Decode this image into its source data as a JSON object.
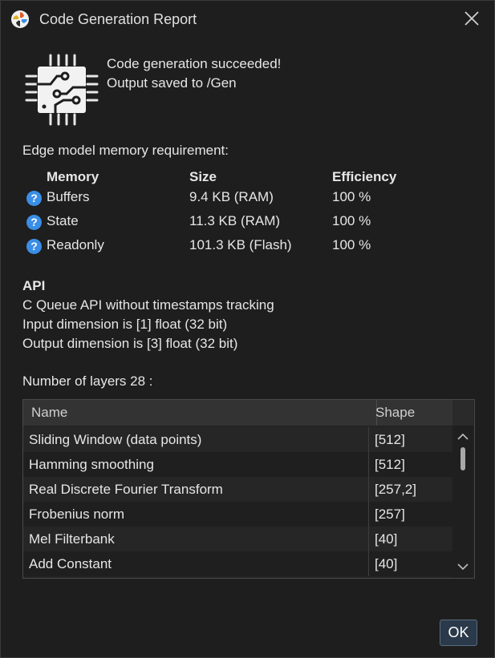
{
  "window": {
    "title": "Code Generation Report",
    "app_icon": "pinwheel-icon",
    "close_icon": "close-icon"
  },
  "status": {
    "icon": "chip-icon",
    "line1": "Code generation succeeded!",
    "line2": "Output saved to /Gen"
  },
  "memory": {
    "heading": "Edge model memory requirement:",
    "columns": [
      "Memory",
      "Size",
      "Efficiency"
    ],
    "help_glyph": "?",
    "rows": [
      {
        "name": "Buffers",
        "size": "9.4 KB (RAM)",
        "efficiency": "100 %"
      },
      {
        "name": "State",
        "size": "11.3 KB (RAM)",
        "efficiency": "100 %"
      },
      {
        "name": "Readonly",
        "size": "101.3 KB (Flash)",
        "efficiency": "100 %"
      }
    ]
  },
  "api": {
    "heading": "API",
    "lines": [
      "C Queue API without timestamps tracking",
      "Input dimension is [1] float (32 bit)",
      "Output dimension is [3] float (32 bit)"
    ]
  },
  "layers": {
    "heading": "Number of layers 28 :",
    "columns": [
      "Name",
      "Shape"
    ],
    "rows": [
      {
        "name": "Sliding Window (data points)",
        "shape": "[512]"
      },
      {
        "name": "Hamming smoothing",
        "shape": "[512]"
      },
      {
        "name": "Real Discrete Fourier Transform",
        "shape": "[257,2]"
      },
      {
        "name": "Frobenius norm",
        "shape": "[257]"
      },
      {
        "name": "Mel Filterbank",
        "shape": "[40]"
      },
      {
        "name": "Add Constant",
        "shape": "[40]"
      }
    ]
  },
  "buttons": {
    "ok": "OK"
  },
  "colors": {
    "background": "#1e1e1e",
    "text": "#e6e6e6",
    "help_icon": "#3a8ee6",
    "row_alt": "#262626",
    "row_base": "#1f1f1f"
  }
}
